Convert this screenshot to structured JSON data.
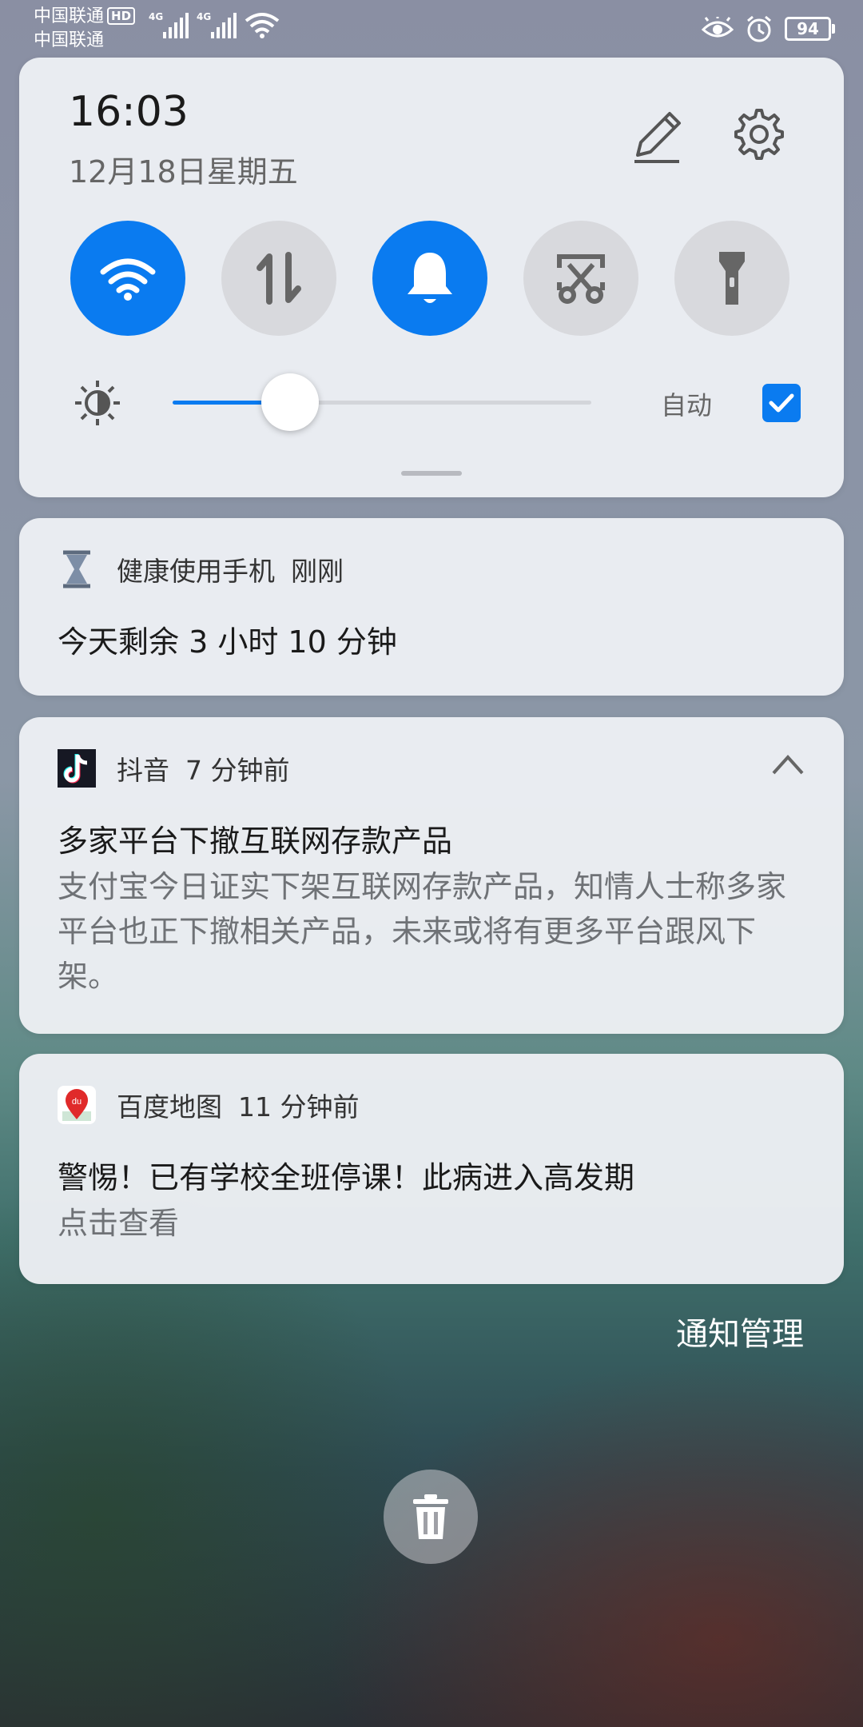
{
  "status_bar": {
    "carrier_1": "中国联通",
    "carrier_hd": "HD",
    "carrier_2": "中国联通",
    "net_1": "4G",
    "net_2": "4G",
    "battery": "94",
    "icons": [
      "eye-icon",
      "alarm-icon",
      "battery-icon",
      "wifi-icon",
      "signal-icon"
    ]
  },
  "quick_settings": {
    "time": "16:03",
    "date": "12月18日星期五",
    "tiles": [
      {
        "name": "wifi",
        "active": true
      },
      {
        "name": "mobile-data",
        "active": false
      },
      {
        "name": "sound",
        "active": true
      },
      {
        "name": "screenshot",
        "active": false
      },
      {
        "name": "flashlight",
        "active": false
      }
    ],
    "brightness_level": 0.28,
    "auto_label": "自动",
    "auto_checked": true,
    "accent_color": "#0a7bf0"
  },
  "notifications": [
    {
      "app": "健康使用手机",
      "time": "刚刚",
      "title": "今天剩余 3 小时 10 分钟"
    },
    {
      "app": "抖音",
      "time": "7 分钟前",
      "title": "多家平台下撤互联网存款产品",
      "body": "支付宝今日证实下架互联网存款产品，知情人士称多家平台也正下撤相关产品，未来或将有更多平台跟风下架。"
    },
    {
      "app": "百度地图",
      "time": "11 分钟前",
      "title": "警惕！已有学校全班停课！此病进入高发期",
      "body": "点击查看",
      "icon_text": "du"
    }
  ],
  "notification_manage": "通知管理"
}
